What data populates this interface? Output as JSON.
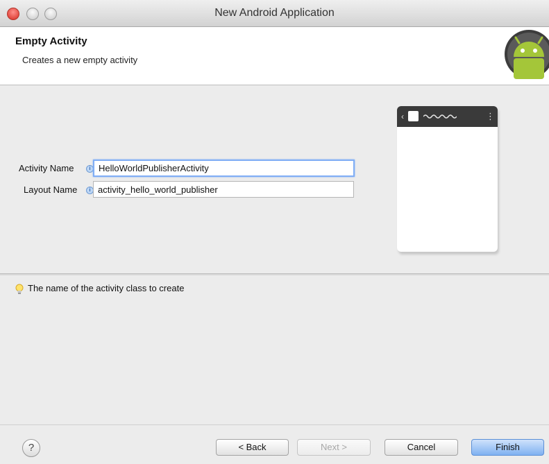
{
  "window": {
    "title": "New Android Application"
  },
  "header": {
    "title": "Empty Activity",
    "description": "Creates a new empty activity"
  },
  "form": {
    "activity_name_label": "Activity Name",
    "activity_name_value": "HelloWorldPublisherActivity",
    "layout_name_label": "Layout Name",
    "layout_name_value": "activity_hello_world_publisher"
  },
  "hint": {
    "text": "The name of the activity class to create",
    "icon": "lightbulb-icon"
  },
  "buttons": {
    "help": "?",
    "back": "< Back",
    "next": "Next >",
    "cancel": "Cancel",
    "finish": "Finish"
  },
  "colors": {
    "accent": "#7fb1f1",
    "android_green": "#a4c639"
  }
}
